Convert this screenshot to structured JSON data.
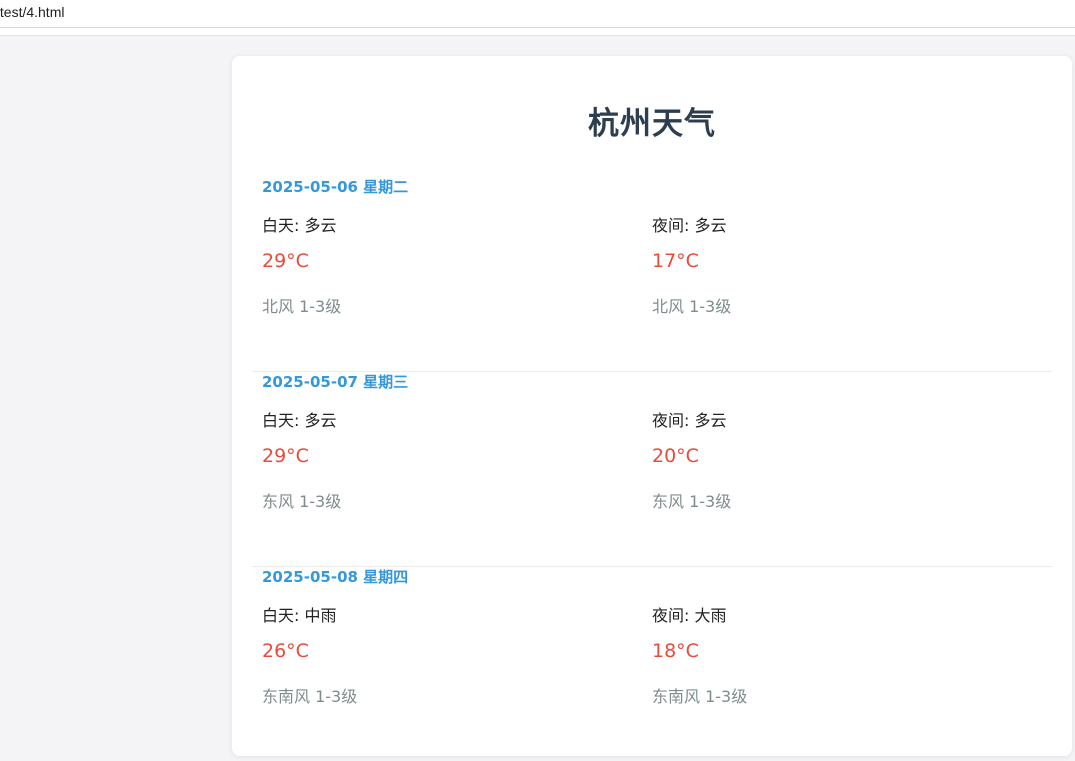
{
  "browser": {
    "url_fragment": "/test/4.html"
  },
  "page": {
    "title": "杭州天气"
  },
  "days": [
    {
      "date": "2025-05-06 星期二",
      "day": {
        "cond": "白天: 多云",
        "temp": "29°C",
        "wind": "北风 1-3级"
      },
      "night": {
        "cond": "夜间: 多云",
        "temp": "17°C",
        "wind": "北风 1-3级"
      }
    },
    {
      "date": "2025-05-07 星期三",
      "day": {
        "cond": "白天: 多云",
        "temp": "29°C",
        "wind": "东风 1-3级"
      },
      "night": {
        "cond": "夜间: 多云",
        "temp": "20°C",
        "wind": "东风 1-3级"
      }
    },
    {
      "date": "2025-05-08 星期四",
      "day": {
        "cond": "白天: 中雨",
        "temp": "26°C",
        "wind": "东南风 1-3级"
      },
      "night": {
        "cond": "夜间: 大雨",
        "temp": "18°C",
        "wind": "东南风 1-3级"
      }
    }
  ],
  "colors": {
    "date": "#3498db",
    "temperature": "#e74c3c",
    "wind": "#7f8c8d",
    "title": "#2c3e50"
  }
}
